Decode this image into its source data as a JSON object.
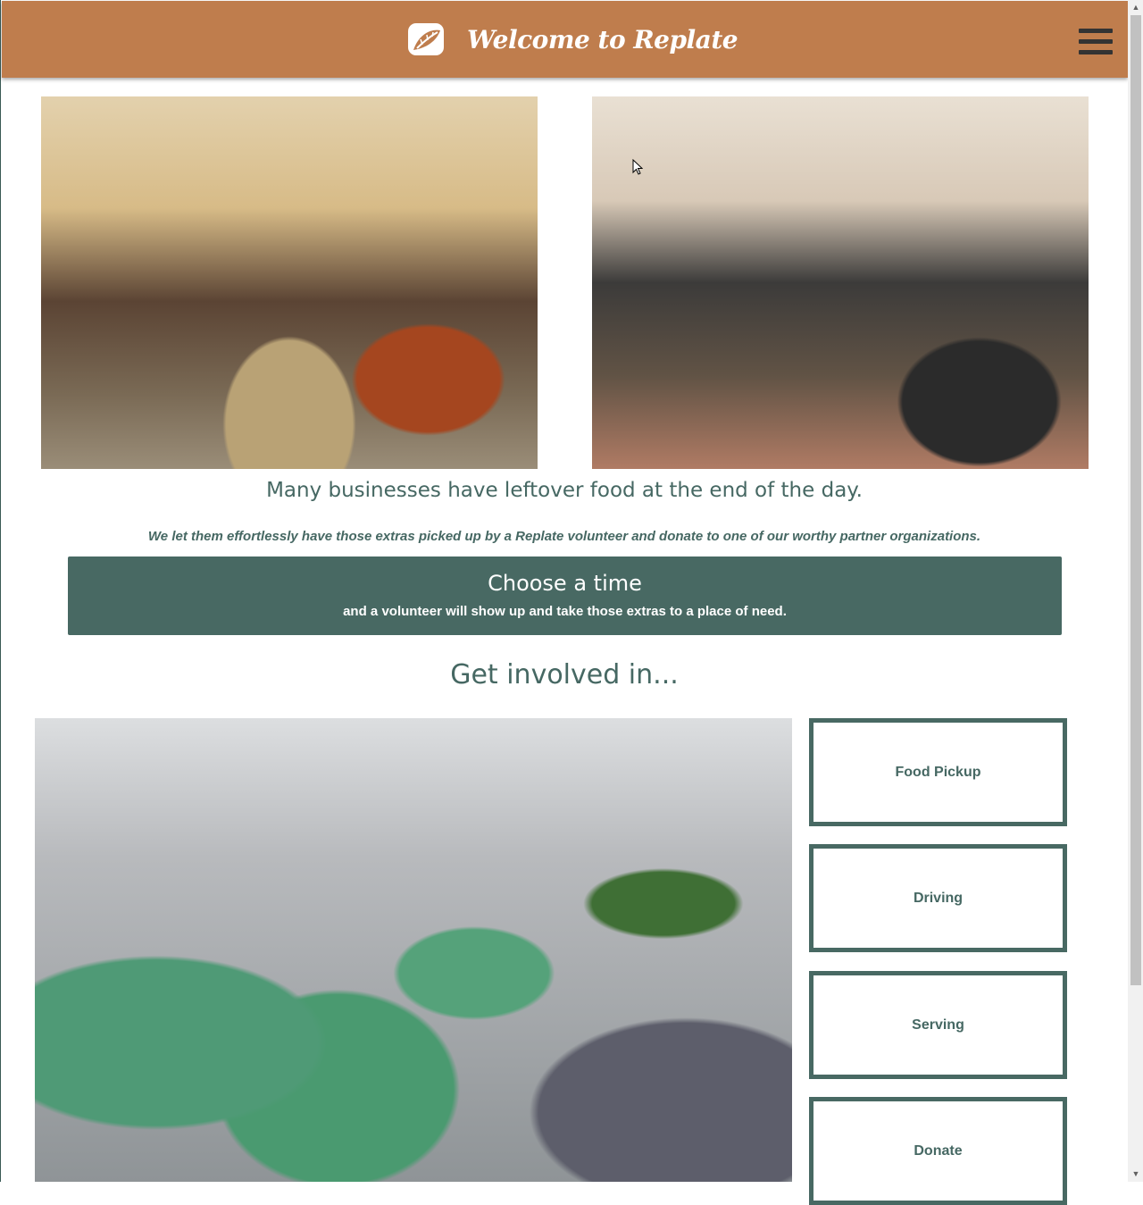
{
  "header": {
    "title": "Welcome to Replate",
    "logo_icon": "replate-leaf-logo-icon",
    "menu_icon": "hamburger-menu-icon",
    "background_color": "#bf7d4d"
  },
  "images": {
    "hero_left": "volunteers-serving-food-photo",
    "hero_right": "volunteers-group-photo",
    "involved": "volunteers-serving-meal-photo"
  },
  "intro": {
    "tagline": "Many businesses have leftover food at the end of the day.",
    "subtagline": "We let them effortlessly have those extras picked up by a Replate volunteer and donate to one of our worthy partner organizations."
  },
  "cta": {
    "title": "Choose a time",
    "subtitle": "and a volunteer will show up and take those extras to a place of need.",
    "background_color": "#486963"
  },
  "involved": {
    "heading": "Get involved in...",
    "options": [
      "Food Pickup",
      "Driving",
      "Serving",
      "Donate"
    ]
  },
  "colors": {
    "accent": "#466863",
    "header": "#bf7d4d"
  }
}
